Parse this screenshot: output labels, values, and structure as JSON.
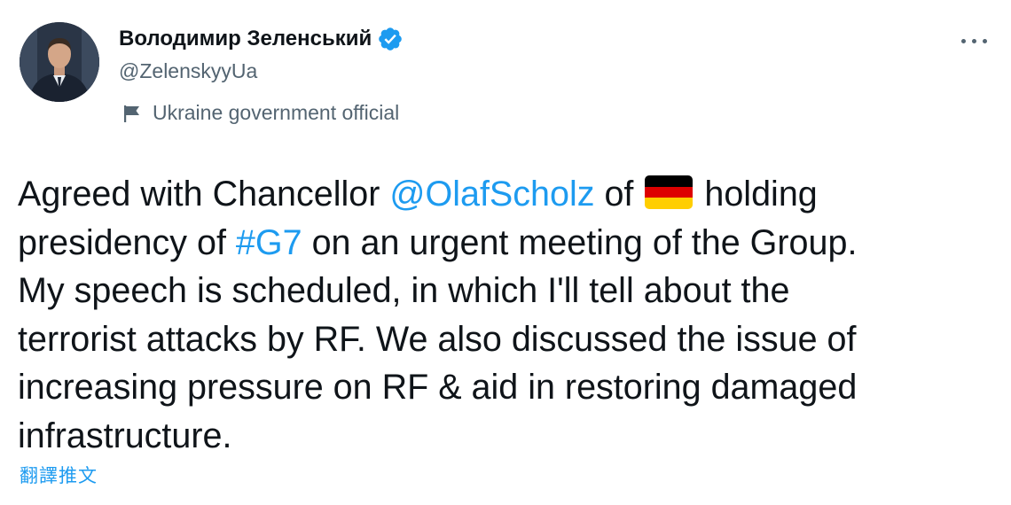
{
  "author": {
    "display_name": "Володимир Зеленський",
    "handle": "@ZelenskyyUa",
    "label": "Ukraine government official",
    "avatar_icon": "profile-photo",
    "verified_icon": "verified-badge-icon",
    "verified_color": "#1d9bf0"
  },
  "tweet": {
    "line1_a": "Agreed with Chancellor ",
    "mention": "@OlafScholz",
    "line1_b": " of ",
    "flag_emoji": "germany-flag",
    "line1_c": " holding",
    "line2_a": "presidency of ",
    "hashtag": "#G7",
    "line2_b": " on an urgent meeting of the Group.",
    "line3": "My speech is scheduled, in which I'll tell about the",
    "line4": "terrorist attacks by RF. We also discussed the issue of",
    "line5": "increasing pressure on RF & aid in restoring damaged",
    "line6": "infrastructure."
  },
  "actions": {
    "translate_label": "翻譯推文",
    "more_icon": "more-options-icon"
  },
  "colors": {
    "link": "#1d9bf0",
    "secondary_text": "#536471",
    "primary_text": "#0f1419"
  }
}
